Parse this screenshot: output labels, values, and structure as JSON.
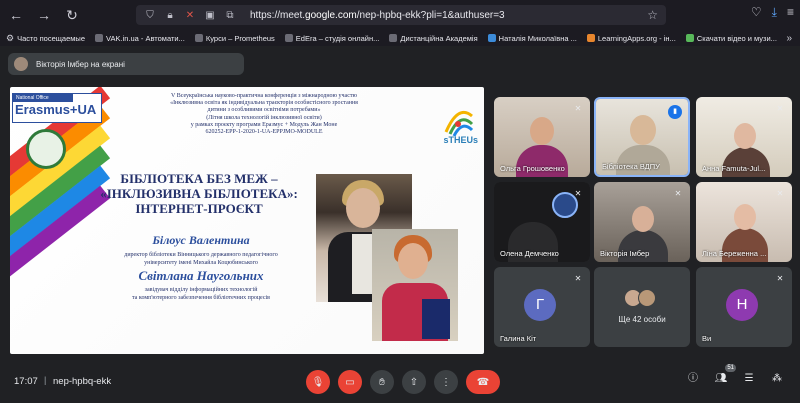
{
  "browser": {
    "url_prefix": "https://meet.",
    "url_domain": "google.com",
    "url_suffix": "/nep-hpbq-ekk?pli=1&authuser=3",
    "bookmarks": [
      {
        "label": "Часто посещаемые",
        "icon": "gear-icon"
      },
      {
        "label": "VAK.in.ua - Автомати...",
        "icon": "globe-icon"
      },
      {
        "label": "Курси – Prometheus",
        "icon": "globe-icon"
      },
      {
        "label": "EdEra – студія онлайн...",
        "icon": "globe-icon"
      },
      {
        "label": "Дистанційна Академія",
        "icon": "globe-icon"
      },
      {
        "label": "Наталія Миколаївна ...",
        "icon": "google-icon"
      },
      {
        "label": "LearningApps.org - ін...",
        "icon": "doc-icon"
      },
      {
        "label": "Скачати відео и музи...",
        "icon": "download-icon"
      }
    ],
    "more_label": "»"
  },
  "presenter": {
    "label": "Вікторія Імбер на екрані"
  },
  "slide": {
    "erasmus_top": "National Office",
    "erasmus_main": "Erasmus+UA",
    "sth_label": "sTHEUs",
    "conference": [
      "V Всеукраїнська науково-практична конференція з міжнародною участю",
      "«Інклюзивна освіта як індивідуальна траєкторія особистісного зростання",
      "дитини з особливими освітніми потребами»",
      "(Літня школа технологій інклюзивної освіти)",
      "у рамках проєкту програми Еразмус + Модуль Жан Моне",
      "620252-EPP-1-2020-1-UA-EPPJMO-MODULE"
    ],
    "title_line1": "БІБЛІОТЕКА БЕЗ МЕЖ –",
    "title_line2": "«ІНКЛЮЗИВНА БІБЛІОТЕКА»:",
    "title_line3": "ІНТЕРНЕТ-ПРОЄКТ",
    "person1_name": "Білоус Валентина",
    "person1_desc_1": "директор бібліотеки Вінницького державного педагогічного",
    "person1_desc_2": "університету імені Михайла Коцюбинського",
    "person2_name": "Світлана Наугольних",
    "person2_desc_1": "завідувач відділу інформаційних технологій",
    "person2_desc_2": "та комп'ютерного забезпечення бібліотечних процесів"
  },
  "participants": [
    {
      "name": "Ольга Грошовенко",
      "muted": true
    },
    {
      "name": "Бібліотека ВДПУ",
      "muted": false,
      "speaking": true
    },
    {
      "name": "Анна Famuta-Jul...",
      "muted": true
    },
    {
      "name": "Олена Демченко",
      "muted": true
    },
    {
      "name": "Вікторія Імбер",
      "muted": true
    },
    {
      "name": "Ліна Береженна ...",
      "muted": true
    },
    {
      "name": "Галина Кіт",
      "muted": true,
      "initial": "Г",
      "color": "#5c6bc0"
    },
    {
      "name": "Ще 42 особи",
      "muted": false
    },
    {
      "name": "Ви",
      "muted": true,
      "initial": "Н",
      "color": "#8e3ab0"
    }
  ],
  "bottom": {
    "time": "17:07",
    "separator": "|",
    "meeting_code": "nep-hpbq-ekk",
    "people_count": "51"
  },
  "colors": {
    "meet_bg": "#202124",
    "tile_bg": "#3c4043",
    "end_call": "#ea4335",
    "active_speaker": "#8ab4f8"
  }
}
